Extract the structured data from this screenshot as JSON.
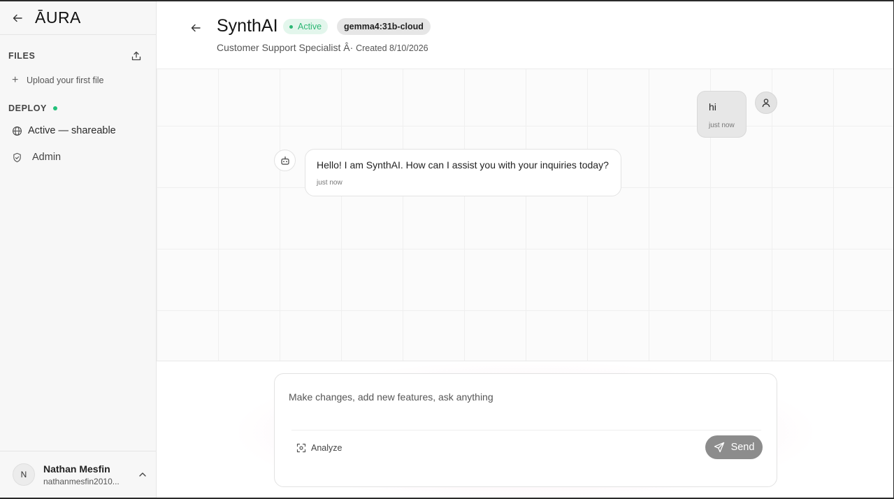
{
  "app": {
    "logo": "ĀURA"
  },
  "sidebar": {
    "files_title": "FILES",
    "upload_first": "Upload your first file",
    "deploy_title": "DEPLOY",
    "items": [
      {
        "label": "Active — shareable",
        "icon": "globe-icon"
      },
      {
        "label": "Admin",
        "icon": "shield-icon"
      }
    ],
    "user": {
      "initial": "N",
      "name": "Nathan Mesfin",
      "email": "nathanmesfin2010..."
    }
  },
  "header": {
    "title": "SynthAI",
    "status_badge": "Active",
    "model_badge": "gemma4:31b-cloud",
    "role": "Customer Support Specialist Â·",
    "created": "Created 8/10/2026"
  },
  "messages": [
    {
      "role": "user",
      "text": "hi",
      "time": "just now"
    },
    {
      "role": "assistant",
      "text": "Hello! I am SynthAI. How can I assist you with your inquiries today?",
      "time": "just now"
    }
  ],
  "composer": {
    "placeholder": "Make changes, add new features, ask anything",
    "analyze_label": "Analyze",
    "send_label": "Send"
  },
  "colors": {
    "active_green": "#2db774",
    "send_button": "#8c8c8c",
    "sidebar_bg": "#f7f7f7"
  }
}
